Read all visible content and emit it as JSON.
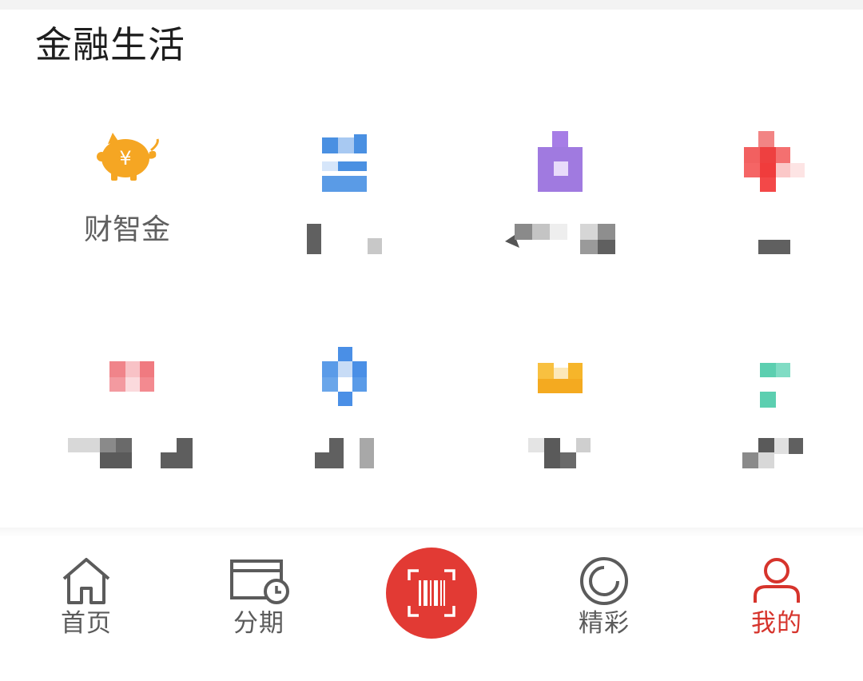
{
  "section": {
    "title": "金融生活"
  },
  "services": [
    {
      "label": "财智金",
      "icon": "piggy-bank-yuan-icon",
      "color": "#f5a623"
    },
    {
      "label": "",
      "icon": "pixelated-blue-icon",
      "color": "#4a90e2"
    },
    {
      "label": "",
      "icon": "pixelated-purple-icon",
      "color": "#9b6bdc"
    },
    {
      "label": "",
      "icon": "pixelated-red-icon",
      "color": "#ef4545"
    },
    {
      "label": "",
      "icon": "pixelated-pink-icon",
      "color": "#f07a80"
    },
    {
      "label": "",
      "icon": "pixelated-blue-diamond-icon",
      "color": "#4a8fe6"
    },
    {
      "label": "",
      "icon": "pixelated-yellow-icon",
      "color": "#f6b52a"
    },
    {
      "label": "",
      "icon": "pixelated-teal-icon",
      "color": "#5ccfb0"
    }
  ],
  "tabbar": {
    "tabs": [
      {
        "label": "首页",
        "icon": "home-icon"
      },
      {
        "label": "分期",
        "icon": "card-clock-icon"
      },
      {
        "label": "",
        "icon": "barcode-scan-icon"
      },
      {
        "label": "精彩",
        "icon": "circle-target-icon"
      },
      {
        "label": "我的",
        "icon": "user-icon",
        "active": true
      }
    ],
    "active_color": "#d6342c",
    "scan_color": "#e23a34"
  }
}
